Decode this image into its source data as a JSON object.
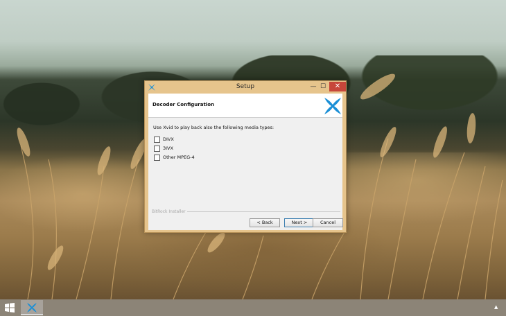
{
  "window": {
    "title": "Setup",
    "minimize_glyph": "—",
    "maximize_glyph": "☐",
    "close_glyph": "✕"
  },
  "page": {
    "title": "Decoder Configuration",
    "instruction": "Use Xvid to play back also the following media types:",
    "options": [
      {
        "label": "DIVX",
        "checked": false
      },
      {
        "label": "3IVX",
        "checked": false
      },
      {
        "label": "Other MPEG-4",
        "checked": false
      }
    ],
    "installer_label": "BitRock Installer"
  },
  "buttons": {
    "back": "< Back",
    "next": "Next >",
    "cancel": "Cancel"
  },
  "taskbar": {
    "tray_arrow": "▲"
  },
  "icons": {
    "app": "xvid-logo-icon",
    "start": "windows-logo-icon"
  },
  "colors": {
    "accent": "#1b8fd6",
    "close": "#c7463a",
    "window_frame": "#e6c48c"
  }
}
